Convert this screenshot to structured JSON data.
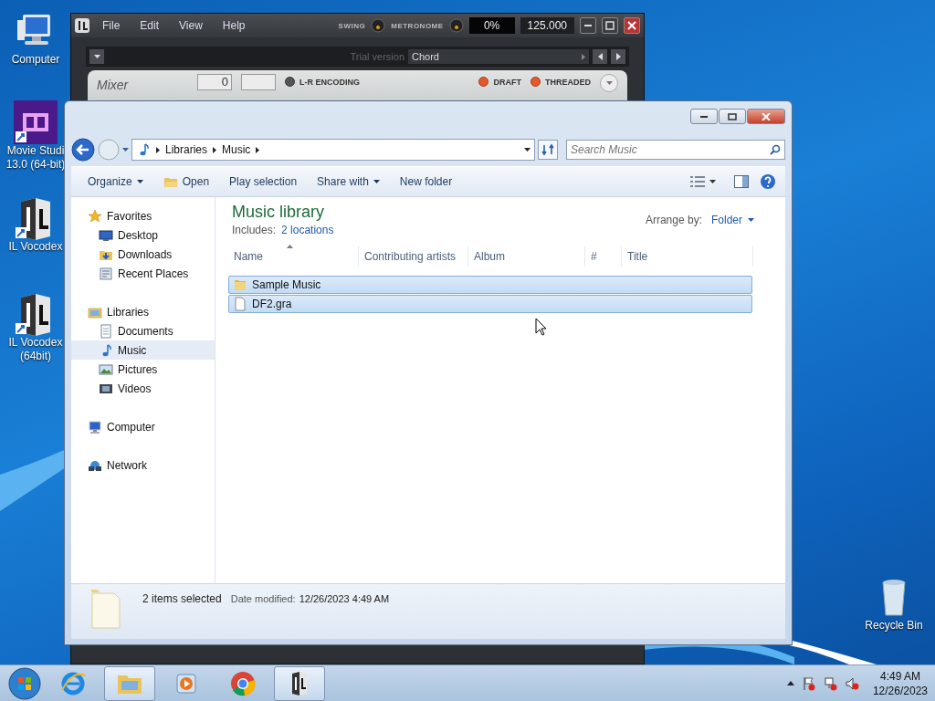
{
  "desktop_icons": [
    {
      "kind": "computer",
      "lines": [
        "Computer"
      ]
    },
    {
      "kind": "movie",
      "lines": [
        "Movie Studi",
        "13.0 (64-bit)"
      ]
    },
    {
      "kind": "vocodex",
      "lines": [
        "IL Vocodex"
      ]
    },
    {
      "kind": "vocodex",
      "lines": [
        "IL Vocodex",
        "(64bit)"
      ]
    }
  ],
  "recycle_bin": {
    "label": "Recycle Bin"
  },
  "vocodex_window": {
    "menu": [
      "File",
      "Edit",
      "View",
      "Help"
    ],
    "swing_label": "SWING",
    "metronome_label": "METRONOME",
    "percent": "0%",
    "tempo": "125.000",
    "trial_label": "Trial version",
    "preset": "Chord",
    "mixer_title": "Mixer",
    "mixer_value": "0",
    "toggles": [
      {
        "label": "L-R ENCODING",
        "on": false
      },
      {
        "label": "DRAFT",
        "on": true
      },
      {
        "label": "THREADED",
        "on": true
      }
    ]
  },
  "explorer_window": {
    "breadcrumb": [
      "Libraries",
      "Music"
    ],
    "search": {
      "placeholder": "Search Music"
    },
    "toolbar": [
      {
        "label": "Organize",
        "kind": "menu"
      },
      {
        "label": "Open",
        "kind": "open"
      },
      {
        "label": "Play selection",
        "kind": "plain"
      },
      {
        "label": "Share with",
        "kind": "menu"
      },
      {
        "label": "New folder",
        "kind": "plain"
      }
    ],
    "navigation": [
      {
        "label": "Favorites",
        "kind": "star",
        "selected": false,
        "children": [
          {
            "label": "Desktop",
            "kind": "desktop",
            "selected": false
          },
          {
            "label": "Downloads",
            "kind": "downloads",
            "selected": false
          },
          {
            "label": "Recent Places",
            "kind": "recent",
            "selected": false
          }
        ]
      },
      {
        "label": "Libraries",
        "kind": "libraries",
        "selected": false,
        "children": [
          {
            "label": "Documents",
            "kind": "documents",
            "selected": false
          },
          {
            "label": "Music",
            "kind": "music",
            "selected": true
          },
          {
            "label": "Pictures",
            "kind": "pictures",
            "selected": false
          },
          {
            "label": "Videos",
            "kind": "videos",
            "selected": false
          }
        ]
      },
      {
        "label": "Computer",
        "kind": "computer",
        "selected": false
      },
      {
        "label": "Network",
        "kind": "network",
        "selected": false
      }
    ],
    "library_title": "Music library",
    "includes_label": "Includes:",
    "includes_link": "2 locations",
    "arrange_label": "Arrange by:",
    "arrange_value": "Folder",
    "columns": [
      "Name",
      "Contributing artists",
      "Album",
      "#",
      "Title"
    ],
    "rows": [
      {
        "name": "Sample Music",
        "kind": "folder",
        "selected": true
      },
      {
        "name": "DF2.gra",
        "kind": "file",
        "selected": true
      }
    ],
    "status": {
      "summary": "2 items selected",
      "date_label": "Date modified:",
      "date_value": "12/26/2023 4:49 AM"
    }
  },
  "taskbar": {
    "apps": [
      {
        "kind": "ie",
        "active": false
      },
      {
        "kind": "explorer",
        "active": true
      },
      {
        "kind": "media",
        "active": false
      },
      {
        "kind": "chrome",
        "active": false
      },
      {
        "kind": "vocodex",
        "active": true
      }
    ],
    "time": "4:49 AM",
    "date": "12/26/2023"
  }
}
